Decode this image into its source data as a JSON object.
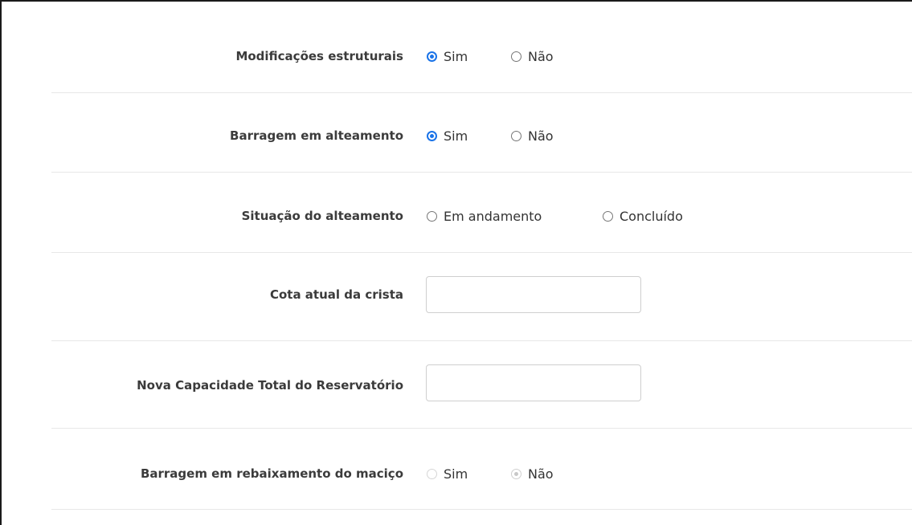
{
  "form": {
    "modificacoes": {
      "label": "Modificações estruturais",
      "options": [
        "Sim",
        "Não"
      ],
      "selected": "Sim"
    },
    "alteamento": {
      "label": "Barragem em alteamento",
      "options": [
        "Sim",
        "Não"
      ],
      "selected": "Sim"
    },
    "situacao": {
      "label": "Situação do alteamento",
      "options": [
        "Em andamento",
        "Concluído"
      ],
      "selected": ""
    },
    "cota": {
      "label": "Cota atual da crista",
      "value": ""
    },
    "capacidade": {
      "label": "Nova Capacidade Total do Reservatório",
      "value": ""
    },
    "rebaixamento": {
      "label": "Barragem em rebaixamento do maciço",
      "options": [
        "Sim",
        "Não"
      ],
      "selected": "Não",
      "disabled": true
    }
  }
}
